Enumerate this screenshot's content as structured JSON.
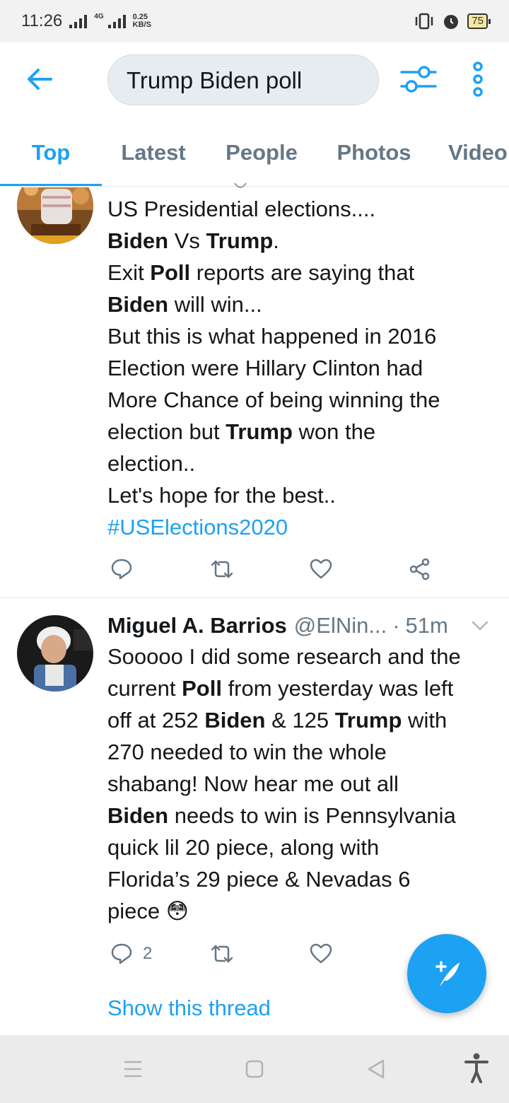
{
  "status_bar": {
    "time": "11:26",
    "network": "4G",
    "speed_value": "0.25",
    "speed_unit": "KB/S",
    "battery": "75"
  },
  "header": {
    "search_query": "Trump Biden poll"
  },
  "tabs": [
    {
      "label": "Top",
      "active": true
    },
    {
      "label": "Latest",
      "active": false
    },
    {
      "label": "People",
      "active": false
    },
    {
      "label": "Photos",
      "active": false
    },
    {
      "label": "Video",
      "active": false
    }
  ],
  "tweets": [
    {
      "lines": [
        [
          {
            "t": "US Presidential elections...."
          }
        ],
        [
          {
            "t": "Biden",
            "b": true
          },
          {
            "t": " Vs "
          },
          {
            "t": "Trump",
            "b": true
          },
          {
            "t": "."
          }
        ],
        [
          {
            "t": "Exit "
          },
          {
            "t": "Poll",
            "b": true
          },
          {
            "t": " reports are saying that"
          }
        ],
        [
          {
            "t": "Biden",
            "b": true
          },
          {
            "t": " will win..."
          }
        ],
        [
          {
            "t": "But this is what happened in 2016"
          }
        ],
        [
          {
            "t": "Election were Hillary Clinton had"
          }
        ],
        [
          {
            "t": "More Chance of being winning the"
          }
        ],
        [
          {
            "t": "election but "
          },
          {
            "t": "Trump",
            "b": true
          },
          {
            "t": " won the"
          }
        ],
        [
          {
            "t": "election.."
          }
        ],
        [
          {
            "t": "Let's hope for the best.."
          }
        ],
        [
          {
            "t": "#USElections2020",
            "h": true
          }
        ]
      ],
      "reply_count": "",
      "accent_color": "#1da1f2"
    },
    {
      "author_name": "Miguel A. Barrios",
      "author_handle": "@ElNin...",
      "separator": "·",
      "time_ago": "51m",
      "lines": [
        [
          {
            "t": "Sooooo I did some research and the"
          }
        ],
        [
          {
            "t": "current "
          },
          {
            "t": "Poll",
            "b": true
          },
          {
            "t": " from yesterday was left"
          }
        ],
        [
          {
            "t": "off at 252 "
          },
          {
            "t": "Biden",
            "b": true
          },
          {
            "t": " & 125 "
          },
          {
            "t": "Trump",
            "b": true
          },
          {
            "t": " with"
          }
        ],
        [
          {
            "t": "270 needed to win the whole"
          }
        ],
        [
          {
            "t": "shabang! Now hear me out all"
          }
        ],
        [
          {
            "t": "Biden",
            "b": true
          },
          {
            "t": " needs to win is Pennsylvania"
          }
        ],
        [
          {
            "t": "quick lil 20 piece, along with"
          }
        ],
        [
          {
            "t": "Florida’s 29 piece & Nevadas 6"
          }
        ],
        [
          {
            "t": "piece 😳"
          }
        ]
      ],
      "reply_count": "2",
      "show_thread_label": "Show this thread"
    }
  ],
  "icons": {
    "back": "arrow-left-icon",
    "filter": "sliders-icon",
    "more": "vertical-dots-icon",
    "reply": "speech-bubble-icon",
    "retweet": "retweet-icon",
    "like": "heart-icon",
    "share": "share-icon",
    "compose": "feather-plus-icon"
  },
  "colors": {
    "accent": "#1da1f2",
    "muted": "#657786",
    "text": "#14171a"
  }
}
